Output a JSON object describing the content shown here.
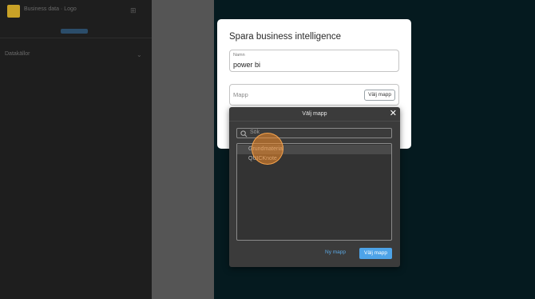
{
  "sidebar": {
    "brand": "Business data · Logo",
    "menu_icon": "menu-icon",
    "section": "Datakällor",
    "chevron_icon": "chevron-down-icon"
  },
  "save_dialog": {
    "title": "Spara business intelligence",
    "name_label": "Namn",
    "name_value": "power bi",
    "folder_placeholder": "Mapp",
    "choose_folder_label": "Välj mapp"
  },
  "folder_picker": {
    "title": "Välj mapp",
    "close_icon": "close-icon",
    "search_icon": "search-icon",
    "search_placeholder": "Sök",
    "folders": [
      "Grundmaterial",
      "QUICKnote"
    ],
    "selected_index": 0,
    "new_folder_label": "Ny mapp",
    "choose_label": "Välj mapp"
  },
  "colors": {
    "accent": "#4da3e8",
    "click_indicator": "#f58c28",
    "background": "#051a1f"
  }
}
